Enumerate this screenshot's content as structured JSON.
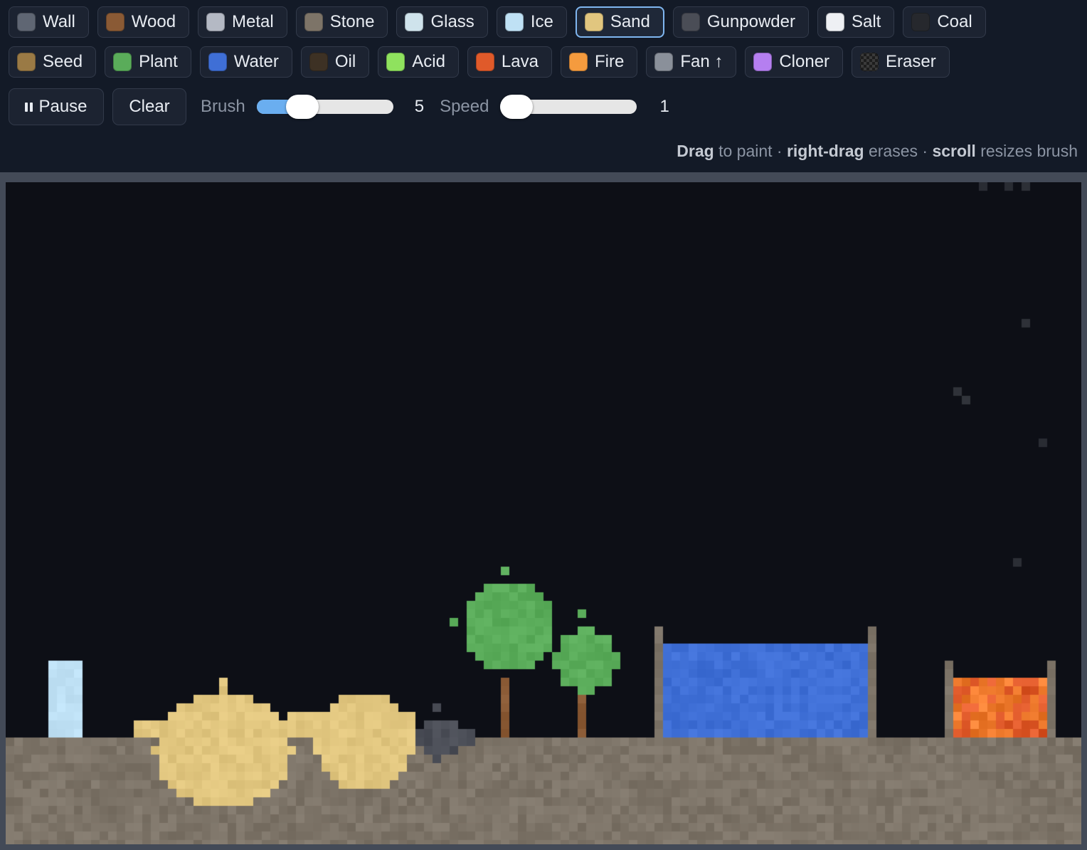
{
  "materials_row1": [
    {
      "id": "wall",
      "label": "Wall",
      "color": "#5f6673",
      "icon": "wall-swatch-icon"
    },
    {
      "id": "wood",
      "label": "Wood",
      "color": "#8a5a35",
      "icon": "wood-swatch-icon"
    },
    {
      "id": "metal",
      "label": "Metal",
      "color": "#b4b9c4",
      "icon": "metal-swatch-icon"
    },
    {
      "id": "stone",
      "label": "Stone",
      "color": "#7d7468",
      "icon": "stone-swatch-icon"
    },
    {
      "id": "glass",
      "label": "Glass",
      "color": "#cfe3ec",
      "icon": "glass-swatch-icon"
    },
    {
      "id": "ice",
      "label": "Ice",
      "color": "#bfe1f5",
      "icon": "ice-swatch-icon"
    },
    {
      "id": "sand",
      "label": "Sand",
      "color": "#e1c67f",
      "icon": "sand-swatch-icon",
      "selected": true
    },
    {
      "id": "gunpowder",
      "label": "Gunpowder",
      "color": "#4a4d56",
      "icon": "gunpowder-swatch-icon"
    },
    {
      "id": "salt",
      "label": "Salt",
      "color": "#eef0f4",
      "icon": "salt-swatch-icon"
    },
    {
      "id": "coal",
      "label": "Coal",
      "color": "#26282d",
      "icon": "coal-swatch-icon"
    }
  ],
  "materials_row2": [
    {
      "id": "seed",
      "label": "Seed",
      "color": "#9a7a45",
      "icon": "seed-swatch-icon"
    },
    {
      "id": "plant",
      "label": "Plant",
      "color": "#5aac5a",
      "icon": "plant-swatch-icon"
    },
    {
      "id": "water",
      "label": "Water",
      "color": "#3f6fd6",
      "icon": "water-swatch-icon"
    },
    {
      "id": "oil",
      "label": "Oil",
      "color": "#3d3124",
      "icon": "oil-swatch-icon"
    },
    {
      "id": "acid",
      "label": "Acid",
      "color": "#8fe25e",
      "icon": "acid-swatch-icon"
    },
    {
      "id": "lava",
      "label": "Lava",
      "color": "#e05a2a",
      "icon": "lava-swatch-icon"
    },
    {
      "id": "fire",
      "label": "Fire",
      "color": "#f59b3e",
      "icon": "fire-swatch-icon"
    },
    {
      "id": "fan",
      "label": "Fan ↑",
      "color": "#8a909a",
      "icon": "fan-swatch-icon"
    },
    {
      "id": "cloner",
      "label": "Cloner",
      "color": "#b57ff0",
      "icon": "cloner-swatch-icon"
    },
    {
      "id": "eraser",
      "label": "Eraser",
      "color": "checker",
      "icon": "eraser-swatch-icon"
    }
  ],
  "controls": {
    "pause_label": "Pause",
    "pause_icon": "pause-icon",
    "clear_label": "Clear",
    "brush_label": "Brush",
    "brush_value": "5",
    "brush_fraction": 0.28,
    "speed_label": "Speed",
    "speed_value": "1",
    "speed_fraction": 0.0
  },
  "hint": {
    "drag": "Drag",
    "drag_rest": " to paint · ",
    "right_drag": "right-drag",
    "right_drag_rest": " erases · ",
    "scroll": "scroll",
    "scroll_rest": " resizes brush"
  },
  "colors": {
    "background": "#0d0f16",
    "stone": "#7d7468",
    "sand": "#e1c67f",
    "plant": "#5aac5a",
    "wood": "#8a5a35",
    "water": "#3f6fd6",
    "lava": "#e05a2a",
    "ice": "#bfe1f5",
    "gunpowder": "#4a4d56",
    "smoke": "#2c2f36",
    "accent": "#7fb6f0"
  }
}
